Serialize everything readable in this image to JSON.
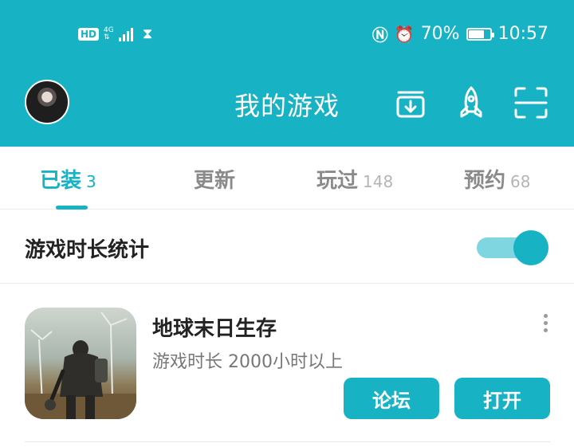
{
  "status_bar": {
    "hd": "HD",
    "network": "4G",
    "battery": "70%",
    "time": "10:57"
  },
  "appbar": {
    "title": "我的游戏"
  },
  "tabs": [
    {
      "label": "已装",
      "count": "3"
    },
    {
      "label": "更新",
      "count": ""
    },
    {
      "label": "玩过",
      "count": "148"
    },
    {
      "label": "预约",
      "count": "68"
    }
  ],
  "stats": {
    "label": "游戏时长统计"
  },
  "game": {
    "name": "地球末日生存",
    "duration": "游戏时长 2000小时以上",
    "forum_button": "论坛",
    "open_button": "打开"
  },
  "colors": {
    "accent": "#17b2c4",
    "toggle_track": "#7fd6e0"
  },
  "icons": [
    "avatar",
    "download-icon",
    "rocket-icon",
    "scan-icon",
    "more-icon"
  ]
}
